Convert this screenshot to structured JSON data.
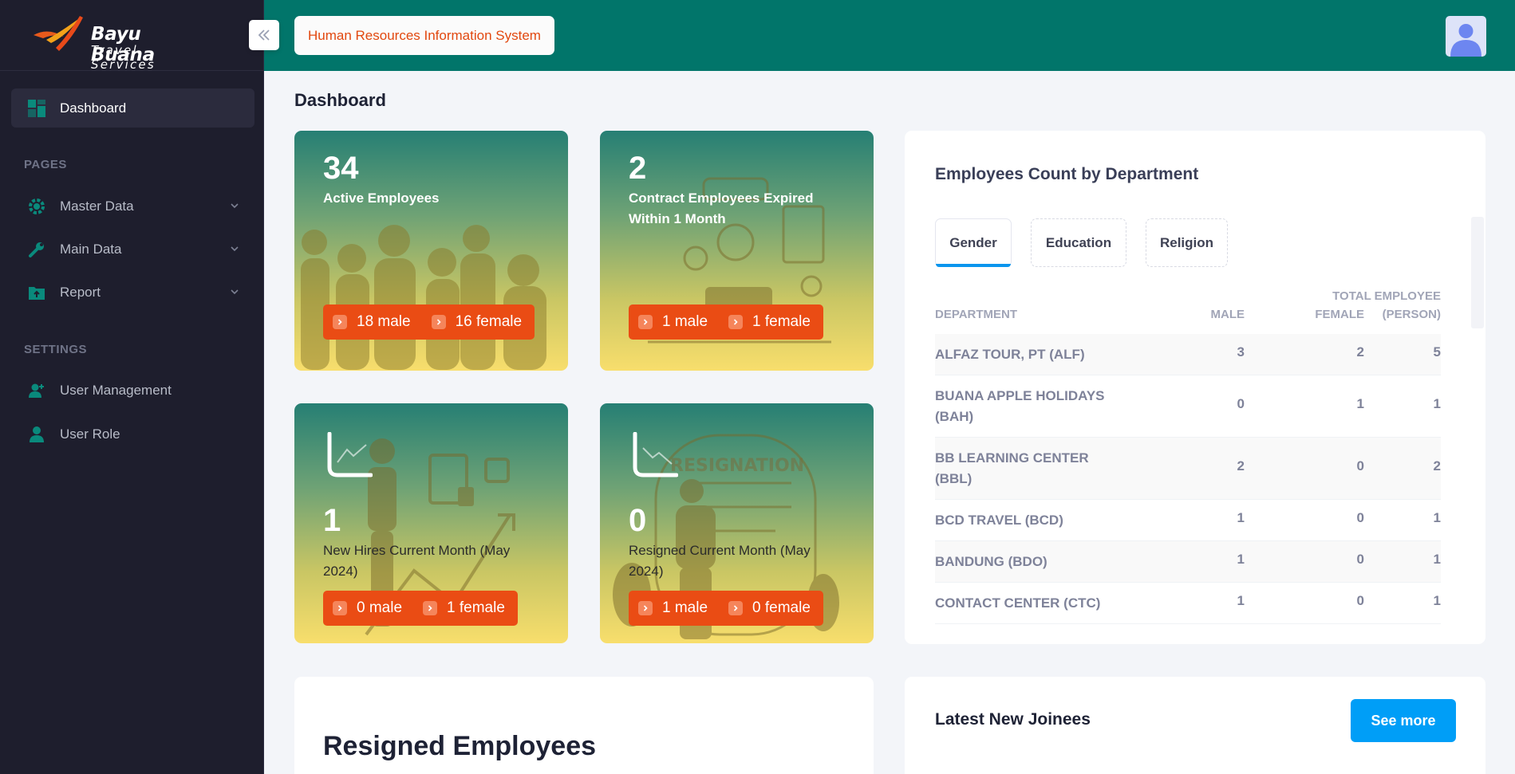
{
  "brand": {
    "name": "Bayu Buana",
    "tagline": "Travel Services"
  },
  "header": {
    "app_title": "Human Resources Information System"
  },
  "sidebar": {
    "dashboard": "Dashboard",
    "pages_title": "PAGES",
    "master_data": "Master Data",
    "main_data": "Main Data",
    "report": "Report",
    "settings_title": "SETTINGS",
    "user_management": "User Management",
    "user_role": "User Role"
  },
  "page": {
    "title": "Dashboard"
  },
  "stats": {
    "active": {
      "value": "34",
      "label": "Active Employees",
      "male": "18 male",
      "female": "16 female"
    },
    "contract": {
      "value": "2",
      "label": "Contract Employees Expired Within 1 Month",
      "male": "1 male",
      "female": "1 female"
    },
    "new_hires": {
      "value": "1",
      "label": "New Hires Current Month (May 2024)",
      "male": "0 male",
      "female": "1 female",
      "illus_text": ""
    },
    "resigned": {
      "value": "0",
      "label": "Resigned Current Month (May 2024)",
      "male": "1 male",
      "female": "0 female",
      "illus_text": "RESIGNATION"
    }
  },
  "department": {
    "title": "Employees Count by Department",
    "tabs": [
      "Gender",
      "Education",
      "Religion"
    ],
    "active_tab": "Gender",
    "headers": {
      "dept": "DEPARTMENT",
      "male": "MALE",
      "female": "FEMALE",
      "total_1": "TOTAL EMPLOYEE",
      "total_2": "(PERSON)"
    },
    "rows": [
      {
        "dept": "ALFAZ TOUR, PT (ALF)",
        "male": "3",
        "female": "2",
        "total": "5"
      },
      {
        "dept": "BUANA APPLE HOLIDAYS (BAH)",
        "male": "0",
        "female": "1",
        "total": "1"
      },
      {
        "dept": "BB LEARNING CENTER (BBL)",
        "male": "2",
        "female": "0",
        "total": "2"
      },
      {
        "dept": "BCD TRAVEL (BCD)",
        "male": "1",
        "female": "0",
        "total": "1"
      },
      {
        "dept": "BANDUNG (BDO)",
        "male": "1",
        "female": "0",
        "total": "1"
      },
      {
        "dept": "CONTACT CENTER (CTC)",
        "male": "1",
        "female": "0",
        "total": "1"
      }
    ]
  },
  "resigned_section": {
    "title": "Resigned Employees"
  },
  "joinees": {
    "title": "Latest New Joinees",
    "see_more": "See more"
  },
  "colors": {
    "header": "#01756a",
    "sidebar": "#1e1e2d",
    "accent": "#ea4c14",
    "primary": "#009ef7"
  }
}
